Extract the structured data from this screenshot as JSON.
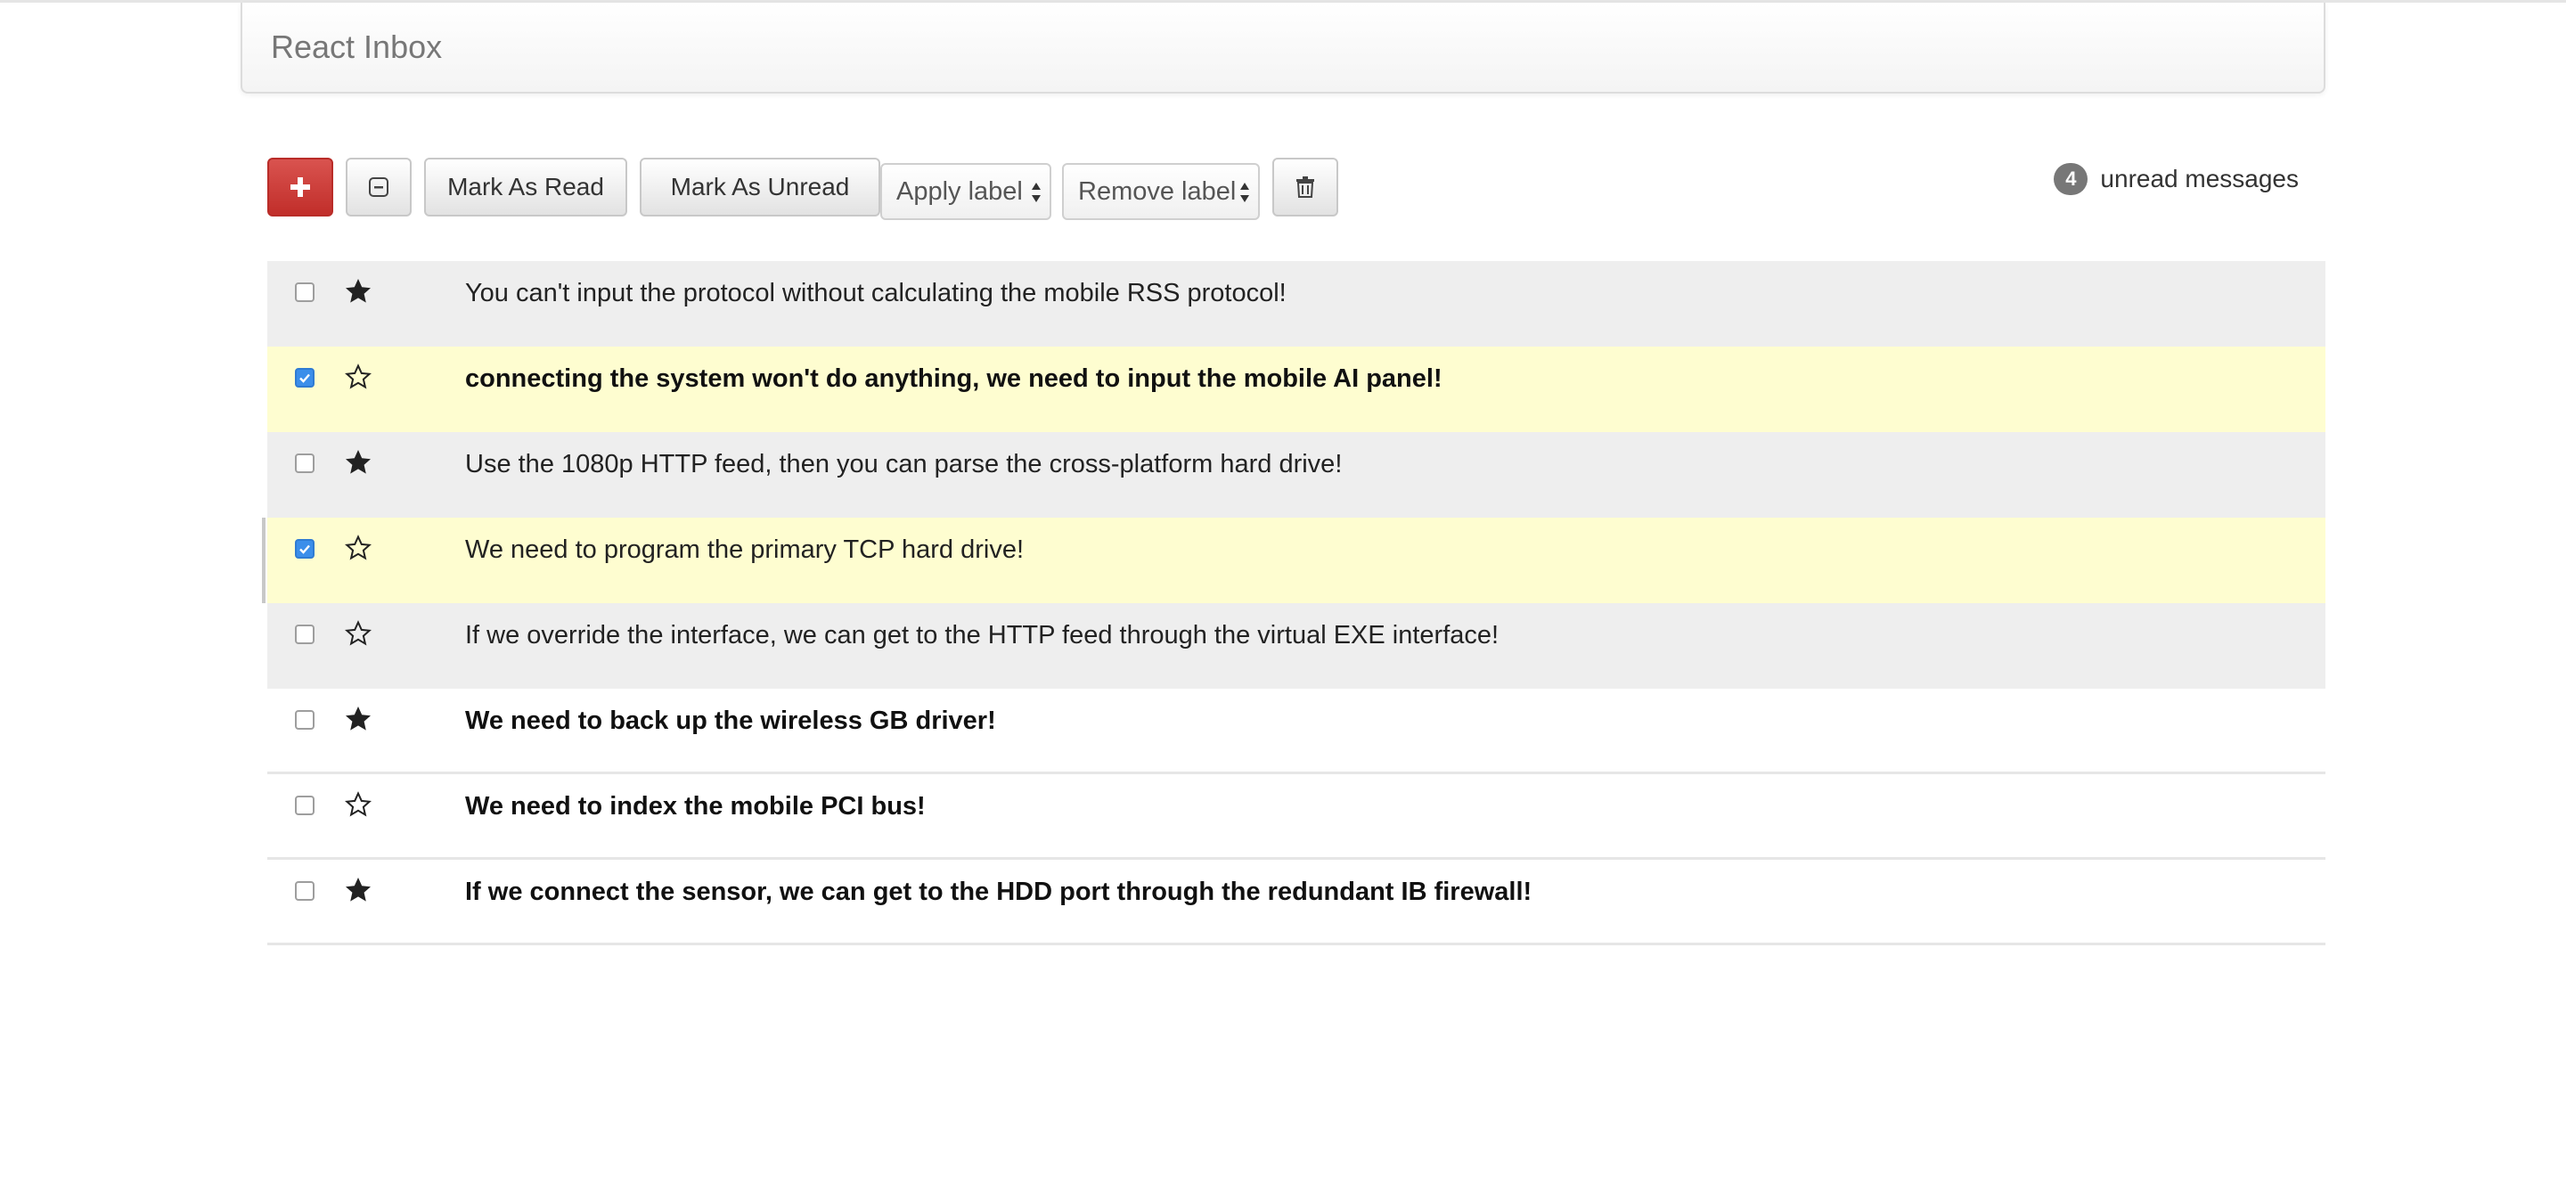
{
  "navbar": {
    "brand": "React Inbox"
  },
  "toolbar": {
    "compose_icon": "plus-icon",
    "select_all_icon": "minus-square-icon",
    "mark_read_label": "Mark As Read",
    "mark_unread_label": "Mark As Unread",
    "apply_label_select": "Apply label",
    "remove_label_select": "Remove label",
    "delete_icon": "trash-icon",
    "unread_count": "4",
    "unread_text": "unread messages"
  },
  "colors": {
    "danger": "#c9302c",
    "selected_row": "#fefdd0",
    "read_row": "#eeeeee",
    "checkbox_checked": "#3b8eea"
  },
  "messages": [
    {
      "subject": "You can't input the protocol without calculating the mobile RSS protocol!",
      "read": true,
      "selected": false,
      "starred": true
    },
    {
      "subject": "connecting the system won't do anything, we need to input the mobile AI panel!",
      "read": false,
      "selected": true,
      "starred": false
    },
    {
      "subject": "Use the 1080p HTTP feed, then you can parse the cross-platform hard drive!",
      "read": true,
      "selected": false,
      "starred": true
    },
    {
      "subject": "We need to program the primary TCP hard drive!",
      "read": true,
      "selected": true,
      "starred": false
    },
    {
      "subject": "If we override the interface, we can get to the HTTP feed through the virtual EXE interface!",
      "read": true,
      "selected": false,
      "starred": false
    },
    {
      "subject": "We need to back up the wireless GB driver!",
      "read": false,
      "selected": false,
      "starred": true
    },
    {
      "subject": "We need to index the mobile PCI bus!",
      "read": false,
      "selected": false,
      "starred": false
    },
    {
      "subject": "If we connect the sensor, we can get to the HDD port through the redundant IB firewall!",
      "read": false,
      "selected": false,
      "starred": true
    }
  ]
}
